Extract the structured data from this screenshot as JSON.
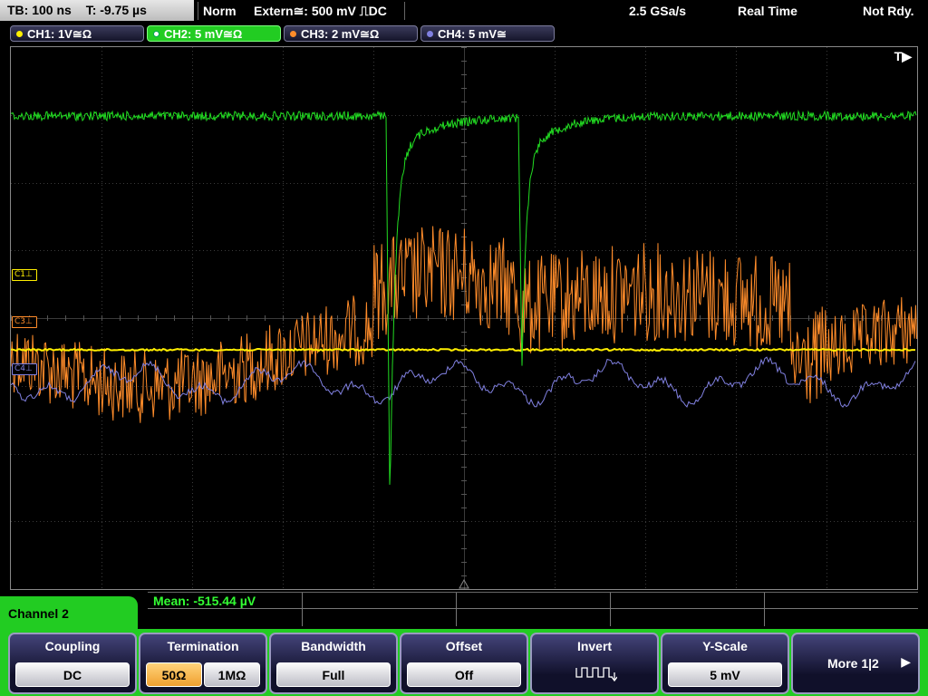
{
  "statusbar": {
    "timebase": "TB: 100 ns",
    "trigger_time": "T: -9.75 µs",
    "mode": "Norm",
    "trigger": "Extern≅: 500 mV ⎍DC",
    "sample_rate": "2.5 GSa/s",
    "acq_mode": "Real Time",
    "state": "Not Rdy."
  },
  "channels": [
    {
      "label": "CH1: 1V≅Ω",
      "color": "#ffee00"
    },
    {
      "label": "CH2: 5 mV≅Ω",
      "color": "#22cc22"
    },
    {
      "label": "CH3: 2 mV≅Ω",
      "color": "#ff8c2a"
    },
    {
      "label": "CH4: 5 mV≅",
      "color": "#8080e0"
    }
  ],
  "screen": {
    "trigger_marker": "T▶",
    "level_markers": [
      "C1⊥",
      "C3⊥",
      "C4⊥"
    ]
  },
  "measurement": {
    "text": "Mean: -515.44 µV"
  },
  "menu": {
    "title": "Channel 2",
    "coupling": {
      "title": "Coupling",
      "value": "DC"
    },
    "termination": {
      "title": "Termination",
      "opt1": "50Ω",
      "opt2": "1MΩ"
    },
    "bandwidth": {
      "title": "Bandwidth",
      "value": "Full"
    },
    "offset": {
      "title": "Offset",
      "value": "Off"
    },
    "invert": {
      "title": "Invert"
    },
    "yscale": {
      "title": "Y-Scale",
      "value": "5 mV"
    },
    "more": {
      "label": "More 1|2",
      "arrow": "▶"
    }
  }
}
